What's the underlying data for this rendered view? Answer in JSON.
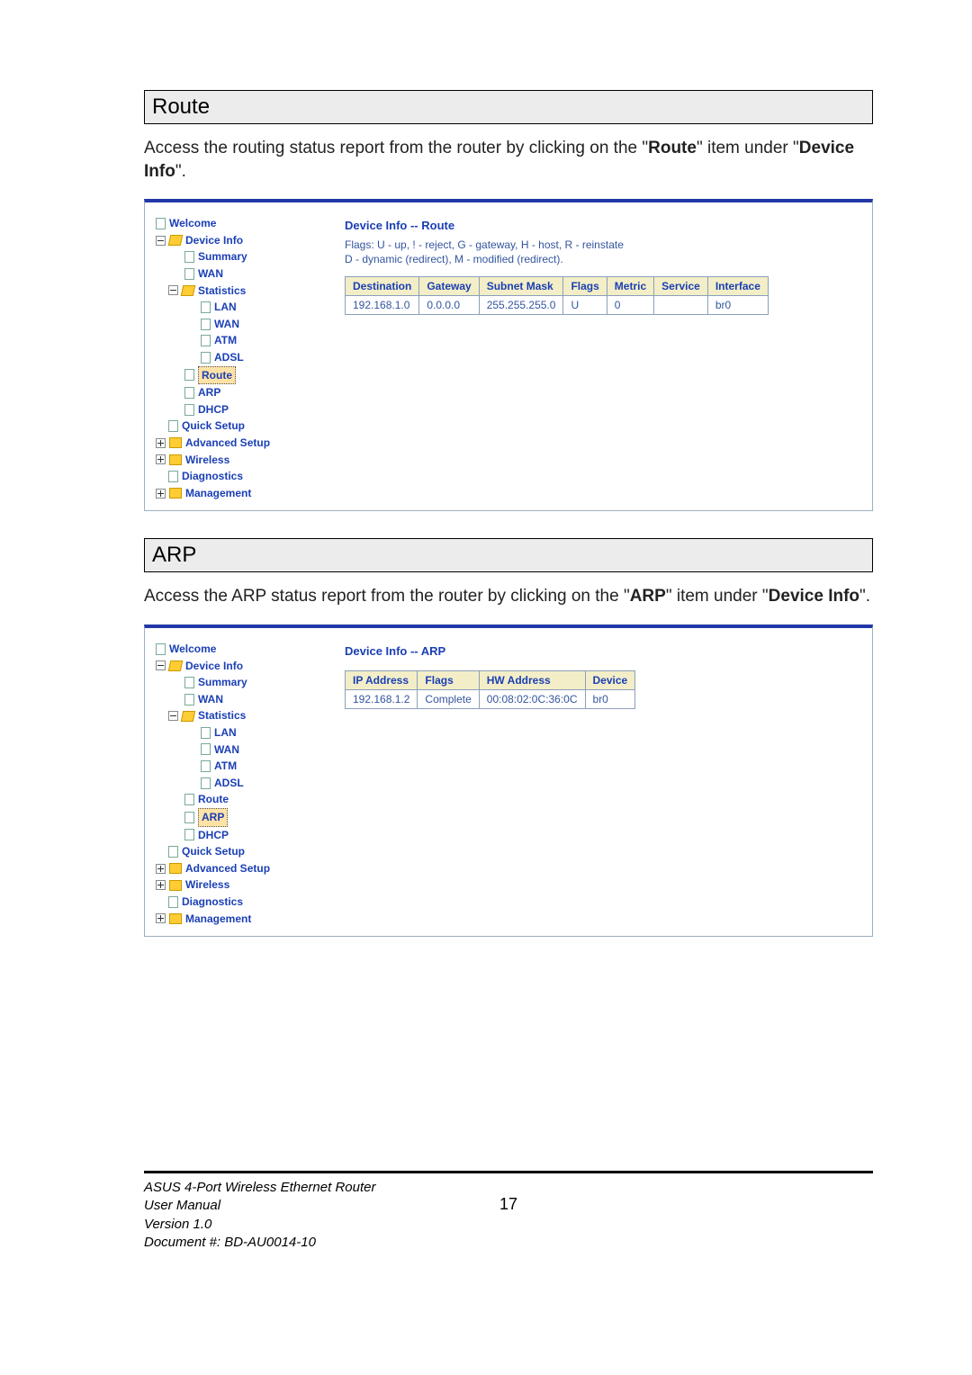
{
  "sections": {
    "route": {
      "header": "Route",
      "para_parts": [
        "Access the routing status report from the router by clicking on the \"",
        "Route",
        "\" item under \"",
        "Device Info",
        "\"."
      ]
    },
    "arp": {
      "header": "ARP",
      "para_parts": [
        "Access the ARP status report from the router by clicking on the \"",
        "ARP",
        "\" item under \"",
        "Device Info",
        "\"."
      ]
    }
  },
  "navtree": {
    "items": [
      "Welcome",
      "Device Info",
      "Summary",
      "WAN",
      "Statistics",
      "LAN",
      "WAN",
      "ATM",
      "ADSL",
      "Route",
      "ARP",
      "DHCP",
      "Quick Setup",
      "Advanced Setup",
      "Wireless",
      "Diagnostics",
      "Management"
    ]
  },
  "route_panel": {
    "title": "Device Info -- Route",
    "meta1": "Flags: U - up, ! - reject, G - gateway, H - host, R - reinstate",
    "meta2": "D - dynamic (redirect), M - modified (redirect).",
    "headers": [
      "Destination",
      "Gateway",
      "Subnet Mask",
      "Flags",
      "Metric",
      "Service",
      "Interface"
    ],
    "row": [
      "192.168.1.0",
      "0.0.0.0",
      "255.255.255.0",
      "U",
      "0",
      "",
      "br0"
    ]
  },
  "arp_panel": {
    "title": "Device Info -- ARP",
    "headers": [
      "IP Address",
      "Flags",
      "HW Address",
      "Device"
    ],
    "row": [
      "192.168.1.2",
      "Complete",
      "00:08:02:0C:36:0C",
      "br0"
    ]
  },
  "footer": {
    "line1": "ASUS 4-Port Wireless Ethernet Router",
    "line2": "User Manual",
    "line3": "Version 1.0",
    "line4": "Document #:  BD-AU0014-10",
    "page": "17"
  }
}
